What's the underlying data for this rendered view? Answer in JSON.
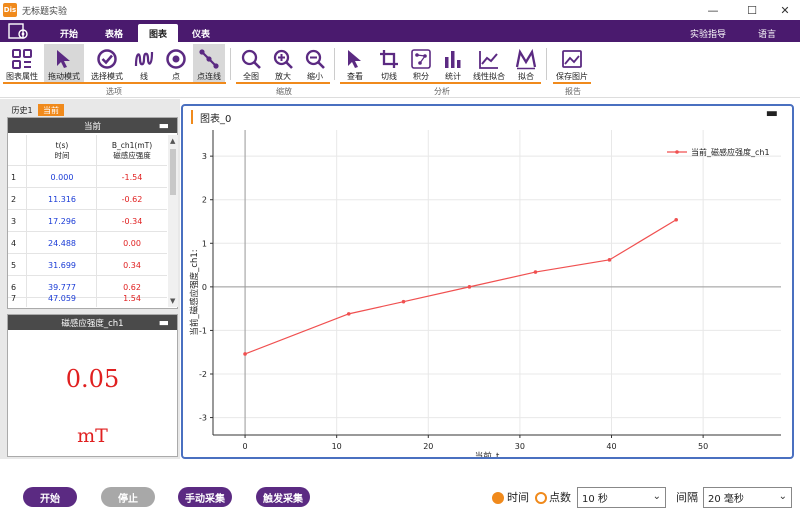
{
  "window": {
    "title": "无标题实验",
    "logo_text": "Dis"
  },
  "menu": {
    "tabs": [
      "开始",
      "表格",
      "图表",
      "仪表"
    ],
    "active_tab": "图表",
    "right": [
      "实验指导",
      "语言"
    ]
  },
  "toolbar": {
    "buttons": [
      {
        "label": "图表属性",
        "icon": "chart-properties-icon"
      },
      {
        "label": "拖动模式",
        "icon": "cursor-icon",
        "selected": true
      },
      {
        "label": "选择模式",
        "icon": "check-circle-icon"
      },
      {
        "label": "线",
        "icon": "line-icon"
      },
      {
        "label": "点",
        "icon": "point-icon"
      },
      {
        "label": "点连线",
        "icon": "point-line-icon",
        "selected": true
      },
      {
        "label": "全图",
        "icon": "zoom-fit-icon"
      },
      {
        "label": "放大",
        "icon": "zoom-in-icon"
      },
      {
        "label": "缩小",
        "icon": "zoom-out-icon"
      },
      {
        "label": "查看",
        "icon": "view-cursor-icon"
      },
      {
        "label": "切线",
        "icon": "tangent-icon"
      },
      {
        "label": "积分",
        "icon": "integral-icon"
      },
      {
        "label": "统计",
        "icon": "statistics-icon"
      },
      {
        "label": "线性拟合",
        "icon": "linear-fit-icon"
      },
      {
        "label": "拟合",
        "icon": "fit-icon"
      },
      {
        "label": "保存图片",
        "icon": "save-image-icon"
      }
    ],
    "groups": [
      "选项",
      "缩放",
      "分析",
      "报告"
    ]
  },
  "side_tabs": [
    "历史1",
    "当前"
  ],
  "current_panel": {
    "title": "当前",
    "col_t": {
      "name": "t(s)",
      "sub": "时间"
    },
    "col_b": {
      "name": "B_ch1(mT)",
      "sub": "磁感应强度"
    },
    "rows": [
      {
        "idx": "1",
        "t": "0.000",
        "b": "-1.54"
      },
      {
        "idx": "2",
        "t": "11.316",
        "b": "-0.62"
      },
      {
        "idx": "3",
        "t": "17.296",
        "b": "-0.34"
      },
      {
        "idx": "4",
        "t": "24.488",
        "b": "0.00"
      },
      {
        "idx": "5",
        "t": "31.699",
        "b": "0.34"
      },
      {
        "idx": "6",
        "t": "39.777",
        "b": "0.62"
      },
      {
        "idx": "7",
        "t": "47.059",
        "b": "1.54"
      }
    ]
  },
  "meter_panel": {
    "title": "磁感应强度_ch1",
    "value": "0.05",
    "unit": "mT"
  },
  "chart_panel": {
    "title": "图表_0"
  },
  "chart_data": {
    "type": "line",
    "series": [
      {
        "name": "当前_磁感应强度_ch1",
        "x": [
          0.0,
          11.316,
          17.296,
          24.488,
          31.699,
          39.777,
          47.059
        ],
        "y": [
          -1.54,
          -0.62,
          -0.34,
          0.0,
          0.34,
          0.62,
          1.54
        ]
      }
    ],
    "xlabel": "当前_t",
    "ylabel": "当前_磁感应强度_ch1:",
    "xticks": [
      0,
      10,
      20,
      30,
      40,
      50
    ],
    "yticks": [
      -3,
      -2,
      -1,
      0,
      1,
      2,
      3
    ],
    "xlim": [
      -3.5,
      58.5
    ],
    "ylim": [
      -3.4,
      3.6
    ],
    "grid": true,
    "legend": "top-right",
    "color": "#f05050"
  },
  "bottom": {
    "start": "开始",
    "stop": "停止",
    "manual": "手动采集",
    "trigger": "触发采集",
    "mode_time": "时间",
    "mode_points": "点数",
    "duration": "10 秒",
    "interval_label": "间隔",
    "interval": "20 毫秒"
  },
  "colors": {
    "accent": "#f08a1c",
    "purple": "#4a1a6e",
    "button_purple": "#5b2a82"
  }
}
